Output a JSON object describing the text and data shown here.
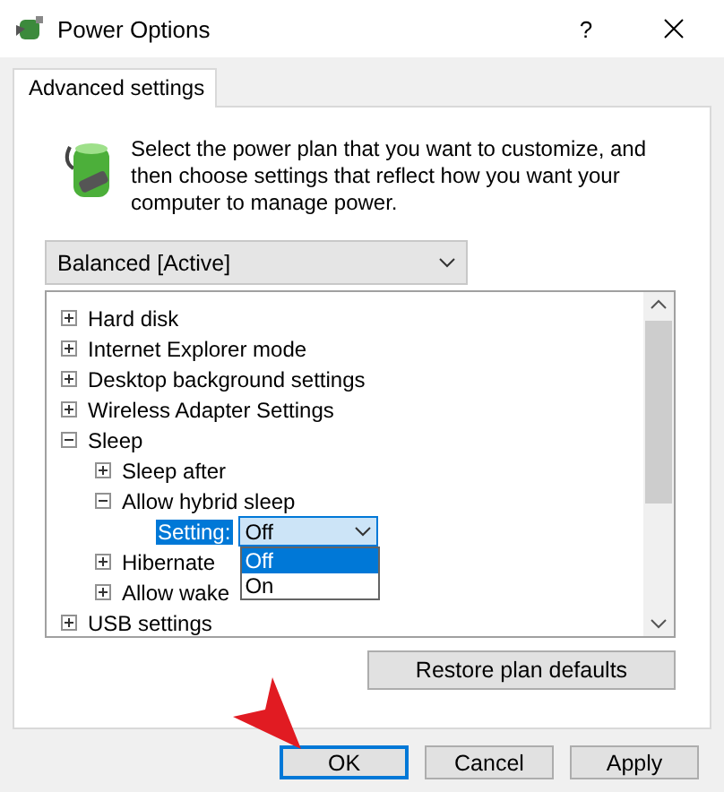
{
  "window": {
    "title": "Power Options",
    "help": "?"
  },
  "tabs": [
    {
      "label": "Advanced settings",
      "selected": true
    }
  ],
  "description": "Select the power plan that you want to customize, and then choose settings that reflect how you want your computer to manage power.",
  "plan_select": {
    "value": "Balanced [Active]"
  },
  "tree": [
    {
      "kind": "group",
      "label": "Hard disk",
      "expanded": false
    },
    {
      "kind": "group",
      "label": "Internet Explorer mode",
      "expanded": false
    },
    {
      "kind": "group",
      "label": "Desktop background settings",
      "expanded": false
    },
    {
      "kind": "group",
      "label": "Wireless Adapter Settings",
      "expanded": false
    },
    {
      "kind": "group",
      "label": "Sleep",
      "expanded": true,
      "children": [
        {
          "kind": "group",
          "label": "Sleep after",
          "expanded": false
        },
        {
          "kind": "group",
          "label": "Allow hybrid sleep",
          "expanded": true,
          "children": [
            {
              "kind": "setting",
              "label": "Setting:",
              "value": "Off",
              "open": true,
              "options": [
                {
                  "label": "Off",
                  "selected": true
                },
                {
                  "label": "On",
                  "selected": false
                }
              ]
            }
          ]
        },
        {
          "kind": "group",
          "label": "Hibernate",
          "expanded": false
        },
        {
          "kind": "group",
          "label": "Allow wake",
          "expanded": false
        }
      ]
    },
    {
      "kind": "group",
      "label": "USB settings",
      "expanded": false
    }
  ],
  "restore_button": "Restore plan defaults",
  "buttons": [
    {
      "label": "OK",
      "default": true
    },
    {
      "label": "Cancel",
      "default": false
    },
    {
      "label": "Apply",
      "default": false
    }
  ]
}
